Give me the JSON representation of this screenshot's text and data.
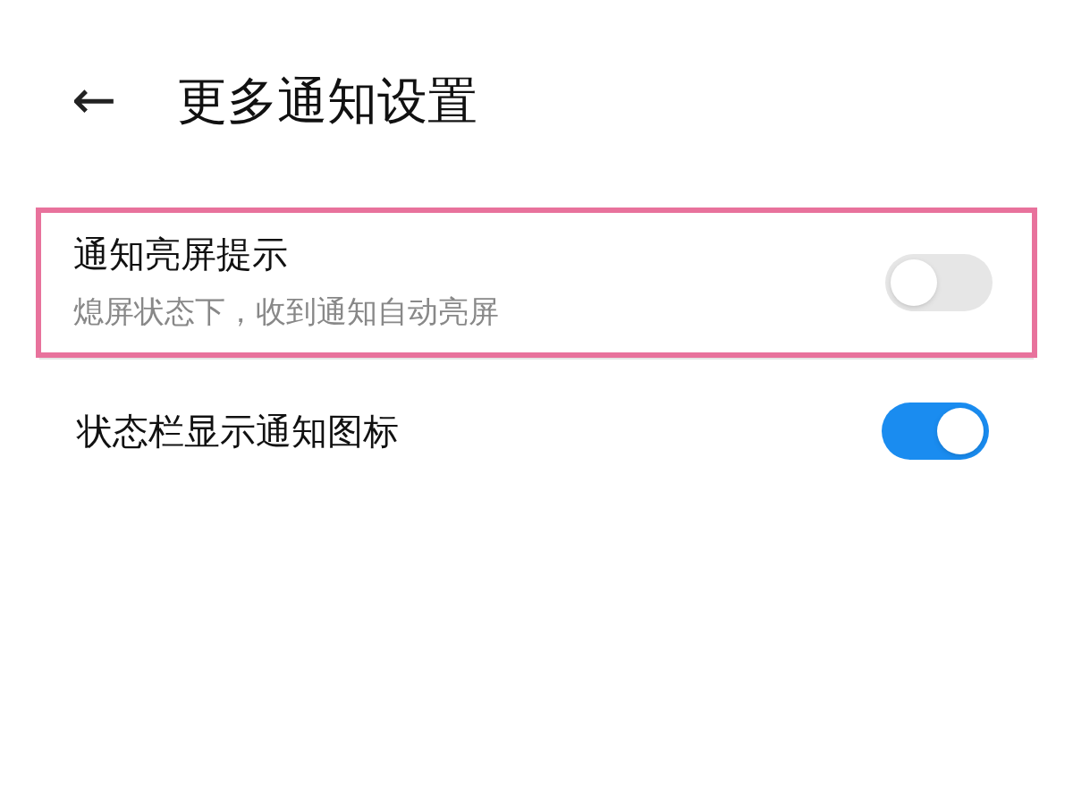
{
  "header": {
    "back": "←",
    "title": "更多通知设置"
  },
  "settings": [
    {
      "title": "通知亮屏提示",
      "subtitle": "熄屏状态下，收到通知自动亮屏",
      "on": false,
      "highlighted": true
    },
    {
      "title": "状态栏显示通知图标",
      "on": true,
      "highlighted": false
    }
  ]
}
